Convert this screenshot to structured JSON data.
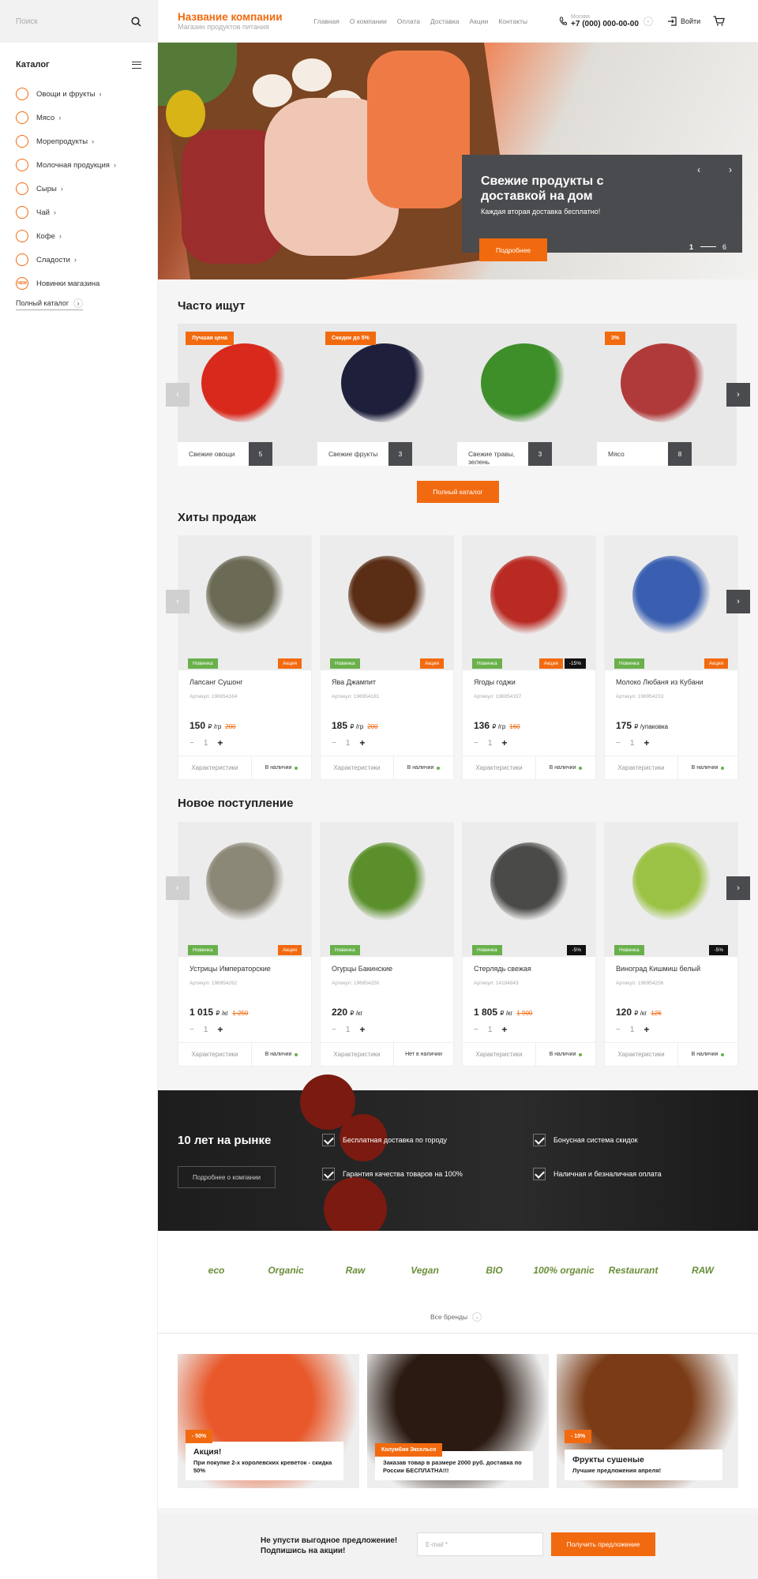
{
  "search": {
    "placeholder": "Поиск"
  },
  "catalog": {
    "title": "Каталог",
    "items": [
      "Овощи и фрукты",
      "Мясо",
      "Морепродукты",
      "Молочная продукция",
      "Сыры",
      "Чай",
      "Кофе",
      "Сладости",
      "Новинки магазина"
    ],
    "new_icon_text": "NEW",
    "full": "Полный каталог"
  },
  "header": {
    "company": "Название компании",
    "tagline": "Магазин продуктов питания",
    "nav": [
      "Главная",
      "О компании",
      "Оплата",
      "Доставка",
      "Акции",
      "Контакты"
    ],
    "city": "Москва",
    "phone": "+7 (000) 000-00-00",
    "login": "Войти"
  },
  "hero": {
    "title": "Свежие продукты с доставкой на дом",
    "subtitle": "Каждая вторая доставка бесплатно!",
    "button": "Подробнее",
    "slide": "1",
    "total": "6"
  },
  "popular": {
    "title": "Часто ищут",
    "items": [
      {
        "tag": "Лучшая цена",
        "label": "Свежие овощи",
        "count": "5",
        "color": "#d8291c"
      },
      {
        "tag": "Скидки до 5%",
        "label": "Свежие фрукты",
        "count": "3",
        "color": "#1e1f3a"
      },
      {
        "tag": "",
        "label": "Свежие травы, зелень",
        "count": "3",
        "color": "#3e8f2a"
      },
      {
        "tag": "3%",
        "label": "Мясо",
        "count": "8",
        "color": "#b03a3a"
      }
    ],
    "button": "Полный каталог"
  },
  "hits": {
    "title": "Хиты продаж",
    "products": [
      {
        "name": "Лапсанг Сушонг",
        "art": "Артикул: 196954164",
        "price": "150",
        "unit": "₽ /гр",
        "old": "200",
        "new": "Новинка",
        "act": "Акция",
        "disc": "",
        "stock": "В наличии",
        "color": "#6b6a55"
      },
      {
        "name": "Ява Джампит",
        "art": "Артикул: 196954181",
        "price": "185",
        "unit": "₽ /гр",
        "old": "200",
        "new": "Новинка",
        "act": "Акция",
        "disc": "",
        "stock": "В наличии",
        "color": "#5a2e15"
      },
      {
        "name": "Ягоды годжи",
        "art": "Артикул: 196954197",
        "price": "136",
        "unit": "₽ /гр",
        "old": "160",
        "new": "Новинка",
        "act": "Акция",
        "disc": "-15%",
        "stock": "В наличии",
        "color": "#b92a22"
      },
      {
        "name": "Молоко Любаня из Кубани",
        "art": "Артикул: 196954233",
        "price": "175",
        "unit": "₽ /упаковка",
        "old": "",
        "new": "Новинка",
        "act": "Акция",
        "disc": "",
        "stock": "В наличии",
        "color": "#3a5fb0"
      }
    ]
  },
  "arrivals": {
    "title": "Новое поступление",
    "products": [
      {
        "name": "Устрицы Императорские",
        "art": "Артикул: 196954262",
        "price": "1 015",
        "unit": "₽ /кг",
        "old": "1 250",
        "new": "Новинка",
        "act": "Акция",
        "disc": "",
        "stock": "В наличии",
        "color": "#8c8878"
      },
      {
        "name": "Огурцы Бакинские",
        "art": "Артикул: 196954250",
        "price": "220",
        "unit": "₽ /кг",
        "old": "",
        "new": "Новинка",
        "act": "",
        "disc": "",
        "stock": "Нет в наличии",
        "color": "#5b8f2c"
      },
      {
        "name": "Стерлядь свежая",
        "art": "Артикул: 14184843",
        "price": "1 805",
        "unit": "₽ /кг",
        "old": "1 900",
        "new": "Новинка",
        "act": "",
        "disc": "-5%",
        "stock": "В наличии",
        "color": "#4a4a48"
      },
      {
        "name": "Виноград Кишмиш белый",
        "art": "Артикул: 196954256",
        "price": "120",
        "unit": "₽ /кг",
        "old": "126",
        "new": "Новинка",
        "act": "",
        "disc": "-5%",
        "stock": "В наличии",
        "color": "#9bc245"
      }
    ]
  },
  "card": {
    "chars": "Характеристики",
    "qty": "1"
  },
  "about": {
    "title": "10 лет на рынке",
    "button": "Подробнее о компании",
    "features": [
      "Бесплатная доставка по городу",
      "Бонусная система скидок",
      "Гарантия качества товаров на 100%",
      "Наличная и безналичная оплата"
    ]
  },
  "brands": {
    "logos": [
      "eco",
      "Organic",
      "Raw",
      "Vegan",
      "BIO",
      "100% organic",
      "Restaurant",
      "RAW"
    ],
    "all": "Все бренды"
  },
  "promos": [
    {
      "tag": "- 50%",
      "title": "Акция!",
      "text": "При покупке 2-х королевских креветок - скидка 50%",
      "color": "#e8582a"
    },
    {
      "tag": "Колумбия Эксельсо",
      "title": "",
      "text": "Заказав товар в размере 2000 руб. доставка по России БЕСПЛАТНА!!!",
      "color": "#2a1a12"
    },
    {
      "tag": "- 15%",
      "title": "Фрукты сушеные",
      "text": "Лучшие предложения апреля!",
      "color": "#7a3b16"
    }
  ],
  "newsletter": {
    "text1": "Не упусти выгодное предложение!",
    "text2": "Подпишись на акции!",
    "placeholder": "E-mail *",
    "button": "Получить предложение"
  }
}
